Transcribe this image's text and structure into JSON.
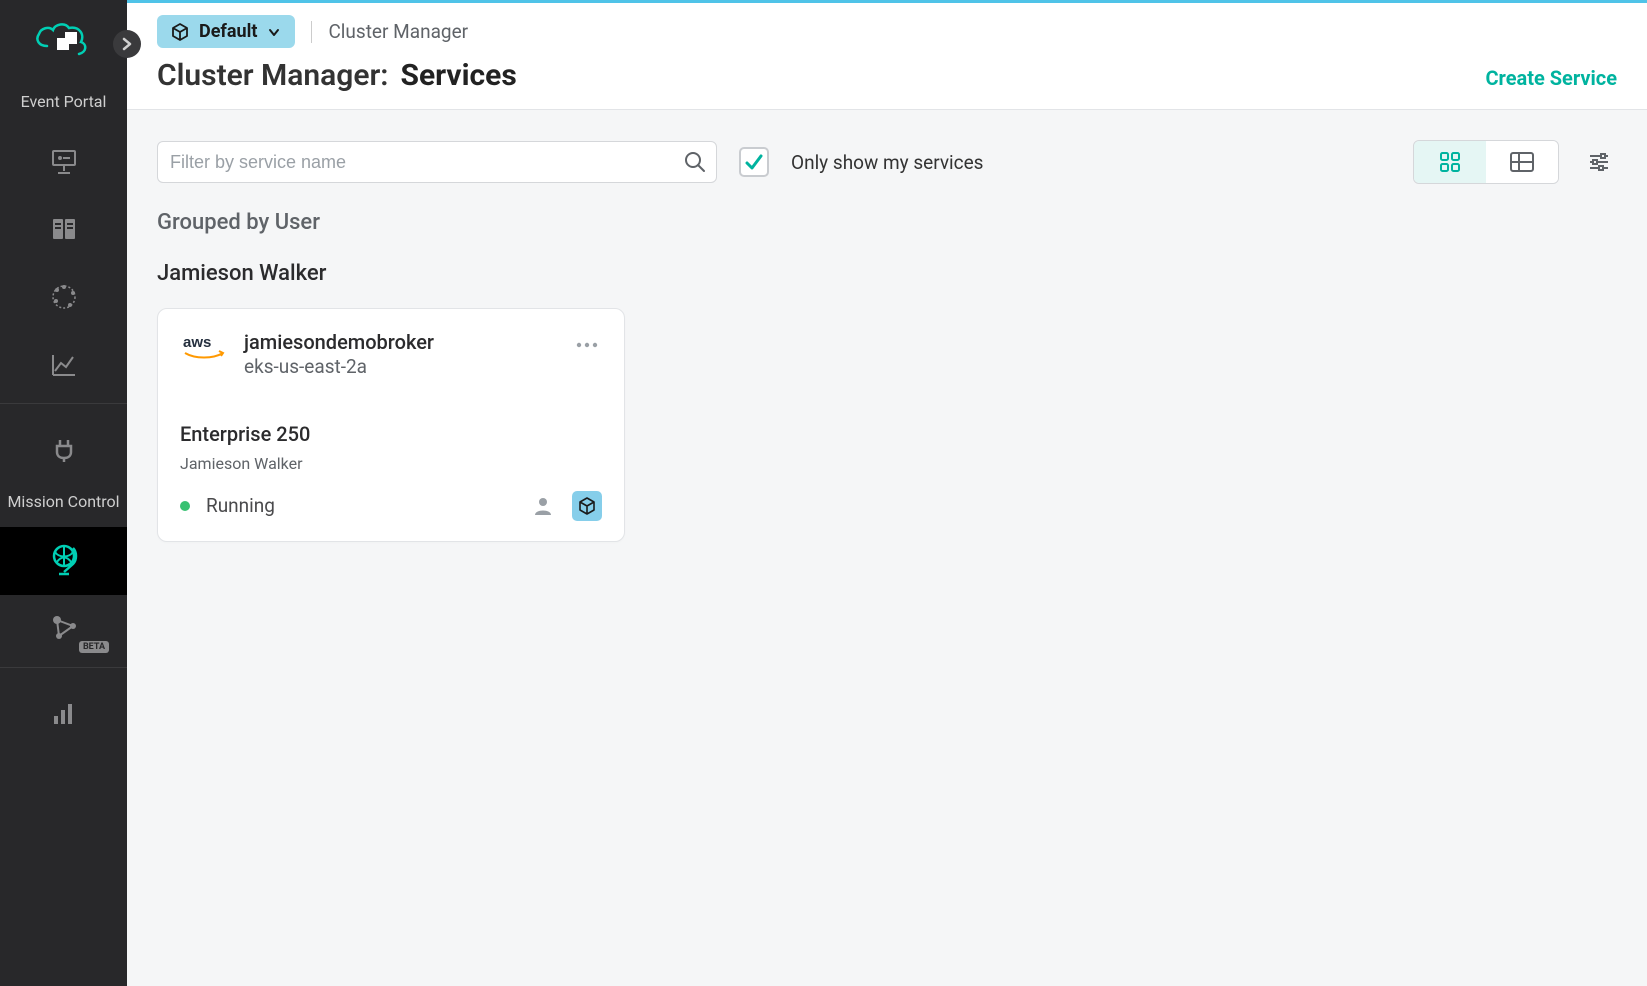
{
  "sidebar": {
    "sections": {
      "event_portal": "Event Portal",
      "mission_control": "Mission Control"
    }
  },
  "header": {
    "workspace": "Default",
    "breadcrumb": "Cluster Manager",
    "page_prefix": "Cluster Manager:",
    "page_title": "Services",
    "create_label": "Create Service"
  },
  "toolbar": {
    "search_placeholder": "Filter by service name",
    "only_mine_label": "Only show my services",
    "only_mine_checked": true
  },
  "grouping": {
    "label": "Grouped by User"
  },
  "groups": [
    {
      "user": "Jamieson Walker",
      "services": [
        {
          "provider": "aws",
          "name": "jamiesondemobroker",
          "region": "eks-us-east-2a",
          "plan": "Enterprise 250",
          "owner": "Jamieson Walker",
          "status": "Running",
          "status_color": "#38c172"
        }
      ]
    }
  ],
  "colors": {
    "accent": "#00b39f",
    "topbar": "#4fc3e8",
    "pill": "#9bd9ec"
  }
}
